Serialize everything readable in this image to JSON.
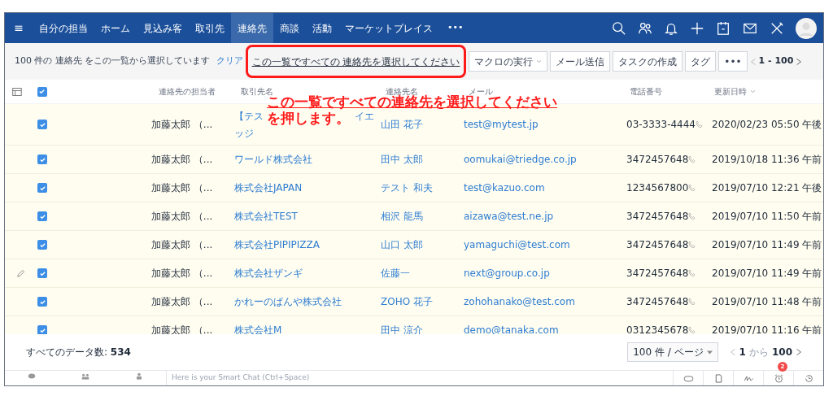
{
  "nav": {
    "menu_icon": "≡",
    "items": [
      {
        "label": "自分の担当",
        "selected": false
      },
      {
        "label": "ホーム",
        "selected": false
      },
      {
        "label": "見込み客",
        "selected": false
      },
      {
        "label": "取引先",
        "selected": false
      },
      {
        "label": "連絡先",
        "selected": true
      },
      {
        "label": "商談",
        "selected": false
      },
      {
        "label": "活動",
        "selected": false
      },
      {
        "label": "マーケットプレイス",
        "selected": false
      }
    ],
    "more": "•••"
  },
  "selection_bar": {
    "message": "100 件の 連絡先 をこの一覧から選択しています",
    "clear": "クリア",
    "select_all": "この一覧ですべての 連絡先を選択してください",
    "buttons": [
      {
        "label": "マクロの実行",
        "dropdown": true
      },
      {
        "label": "メール送信",
        "dropdown": false
      },
      {
        "label": "タスクの作成",
        "dropdown": false
      },
      {
        "label": "タグ",
        "dropdown": false
      },
      {
        "label": "•••",
        "dropdown": false
      }
    ],
    "range": "1 - 100"
  },
  "annotation": {
    "lines": [
      "この一覧ですべての連絡先を選択してください",
      "を押します。"
    ]
  },
  "table": {
    "header_checked": true,
    "columns": [
      "連絡先の担当者",
      "取引先名",
      "連絡先名",
      "メール",
      "電話番号",
      "更新日時"
    ],
    "rows": [
      {
        "checked": true,
        "edit_icon": false,
        "owner": "加藤太郎 （...",
        "company_fragments": [
          "【テス",
          "イエ",
          "ッジ"
        ],
        "contact": "山田 花子",
        "email": "test@mytest.jp",
        "phone": "03-3333-4444",
        "updated": "2020/02/23 05:50 午後"
      },
      {
        "checked": true,
        "edit_icon": false,
        "owner": "加藤太郎 （...",
        "company_fragments": [
          "ワールド株式会社"
        ],
        "contact": "田中 太郎",
        "email": "oomukai@triedge.co.jp",
        "phone": "3472457648",
        "updated": "2019/10/18 11:36 午前"
      },
      {
        "checked": true,
        "edit_icon": false,
        "owner": "加藤太郎 （...",
        "company_fragments": [
          "株式会社JAPAN"
        ],
        "contact": "テスト 和夫",
        "email": "test@kazuo.com",
        "phone": "1234567800",
        "updated": "2019/07/10 12:21 午後"
      },
      {
        "checked": true,
        "edit_icon": false,
        "owner": "加藤太郎 （...",
        "company_fragments": [
          "株式会社TEST"
        ],
        "contact": "相沢 龍馬",
        "email": "aizawa@test.ne.jp",
        "phone": "3472457648",
        "updated": "2019/07/10 11:50 午前"
      },
      {
        "checked": true,
        "edit_icon": false,
        "owner": "加藤太郎 （...",
        "company_fragments": [
          "株式会社PIPIPIZZA"
        ],
        "contact": "山口 太郎",
        "email": "yamaguchi@test.com",
        "phone": "3472457648",
        "updated": "2019/07/10 11:49 午前"
      },
      {
        "checked": true,
        "edit_icon": true,
        "owner": "加藤太郎 （...",
        "company_fragments": [
          "株式会社ザンギ"
        ],
        "contact": "佐藤一",
        "email": "next@group.co.jp",
        "phone": "3472457648",
        "updated": "2019/07/10 11:49 午前"
      },
      {
        "checked": true,
        "edit_icon": false,
        "owner": "加藤太郎 （...",
        "company_fragments": [
          "かれーのぱんや株式会社"
        ],
        "contact": "ZOHO 花子",
        "email": "zohohanako@test.com",
        "phone": "3472457648",
        "updated": "2019/07/10 11:48 午前"
      },
      {
        "checked": true,
        "edit_icon": false,
        "owner": "加藤太郎 （...",
        "company_fragments": [
          "株式会社M"
        ],
        "contact": "田中 涼介",
        "email": "demo@tanaka.com",
        "phone": "0312345678",
        "updated": "2019/07/10 11:16 午前"
      }
    ]
  },
  "footer": {
    "total_label": "すべてのデータ数:",
    "total": "534",
    "per_page": "100 件 / ページ",
    "page_from": "1",
    "page_sep": "から",
    "page_to": "100"
  },
  "chat_bar": {
    "placeholder": "Here is your Smart Chat (Ctrl+Space)",
    "reminder_badge": "2"
  }
}
